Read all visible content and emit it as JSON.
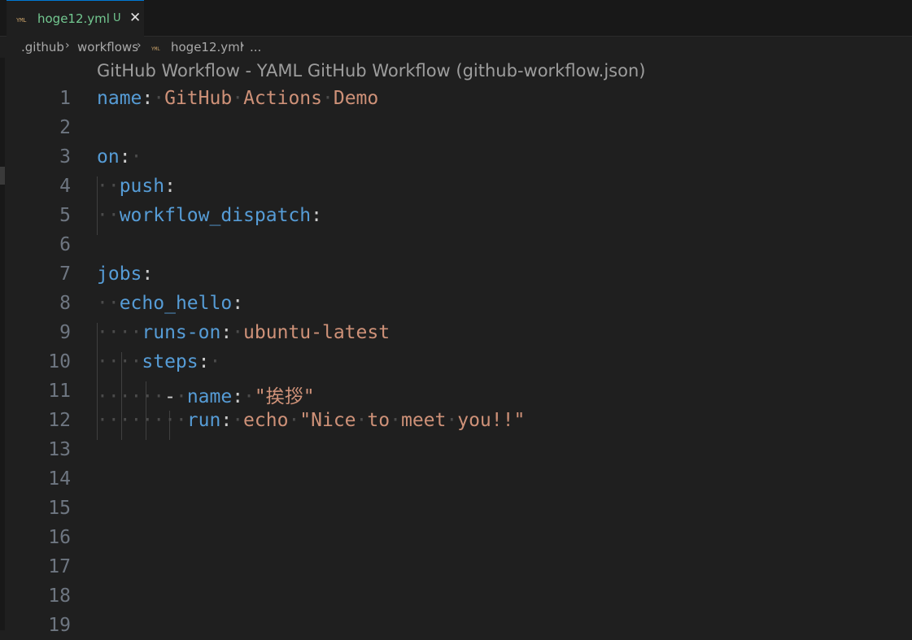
{
  "tab": {
    "icon": "yaml-file-icon",
    "filename": "hoge12.yml",
    "status": "U",
    "close_glyph": "✕"
  },
  "breadcrumb": {
    "items": [
      ".github",
      "workflows",
      "hoge12.yml",
      "..."
    ],
    "separator": "›"
  },
  "schema_hint": "GitHub Workflow - YAML GitHub Workflow (github-workflow.json)",
  "colors": {
    "key": "#569cd6",
    "string": "#ce9178",
    "line_number": "#6e7681",
    "tab_label": "#73c991",
    "accent": "#0078d4"
  },
  "editor": {
    "line_numbers": [
      "1",
      "2",
      "3",
      "4",
      "5",
      "6",
      "7",
      "8",
      "9",
      "10",
      "11",
      "12",
      "13",
      "14",
      "15",
      "16",
      "17",
      "18",
      "19"
    ],
    "lines": [
      {
        "key": "name",
        "colon": ":",
        "value_parts": [
          "GitHub",
          "Actions",
          "Demo"
        ]
      },
      {},
      {
        "key": "on",
        "colon": ":"
      },
      {
        "key": "push",
        "colon": ":"
      },
      {
        "key": "workflow_dispatch",
        "colon": ":"
      },
      {},
      {
        "key": "jobs",
        "colon": ":"
      },
      {
        "key": "echo_hello",
        "colon": ":"
      },
      {
        "key": "runs-on",
        "colon": ":",
        "value": "ubuntu-latest"
      },
      {
        "key": "steps",
        "colon": ":"
      },
      {
        "dash": "-",
        "key": "name",
        "colon": ":",
        "value": "\"挨拶\""
      },
      {
        "key": "run",
        "colon": ":",
        "value_parts": [
          "echo",
          "\"Nice",
          "to",
          "meet",
          "you!!\""
        ]
      }
    ]
  }
}
